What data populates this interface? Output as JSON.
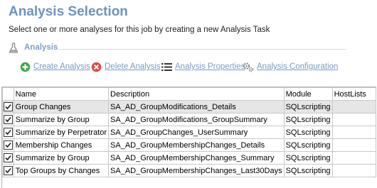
{
  "header": {
    "title": "Analysis Selection",
    "subtitle": "Select one or more analyses for this job by creating a new Analysis Task"
  },
  "section": {
    "label": "Analysis"
  },
  "toolbar": {
    "create_label": "Create Analysis",
    "delete_label": "Delete Analysis",
    "properties_label": "Analysis Properties",
    "configuration_label": "Analysis Configuration"
  },
  "colors": {
    "accent": "#6b93c0",
    "link": "#7a9cc6",
    "create": "#3ea84a",
    "delete": "#e4473e"
  },
  "table": {
    "columns": [
      "Name",
      "Description",
      "Module",
      "HostLists"
    ],
    "rows": [
      {
        "checked": true,
        "name": "Group Changes",
        "description": "SA_AD_GroupModifications_Details",
        "module": "SQLscripting",
        "hostlists": ""
      },
      {
        "checked": true,
        "name": "Summarize by Group",
        "description": "SA_AD_GroupModifications_GroupSummary",
        "module": "SQLscripting",
        "hostlists": ""
      },
      {
        "checked": true,
        "name": "Summarize by Perpetrator",
        "description": "SA_AD_GroupChanges_UserSummary",
        "module": "SQLscripting",
        "hostlists": ""
      },
      {
        "checked": true,
        "name": "Membership Changes",
        "description": "SA_AD_GroupMembershipChanges_Details",
        "module": "SQLscripting",
        "hostlists": ""
      },
      {
        "checked": true,
        "name": "Summarize by Group",
        "description": "SA_AD_GroupMembershipChanges_Summary",
        "module": "SQLscripting",
        "hostlists": ""
      },
      {
        "checked": true,
        "name": "Top Groups by Changes",
        "description": "SA_AD_GroupMembershipChanges_Last30Days",
        "module": "SQLscripting",
        "hostlists": ""
      }
    ]
  }
}
